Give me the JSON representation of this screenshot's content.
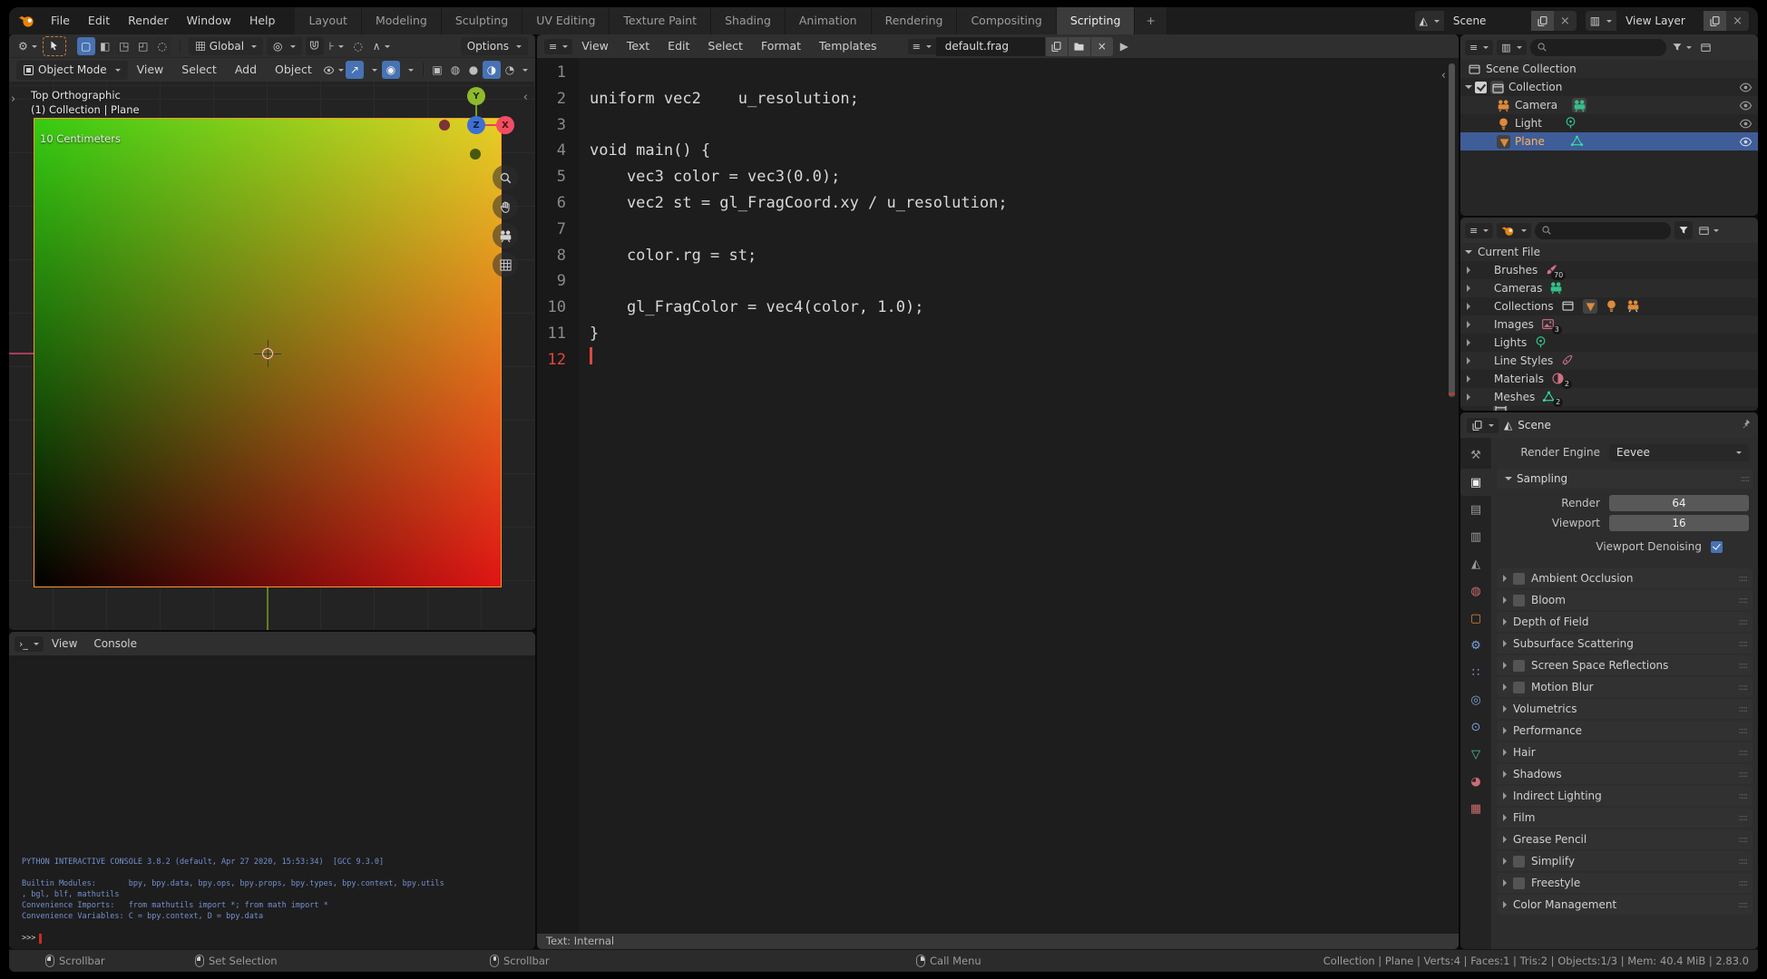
{
  "topbar": {
    "menus": [
      "File",
      "Edit",
      "Render",
      "Window",
      "Help"
    ],
    "tabs": [
      "Layout",
      "Modeling",
      "Sculpting",
      "UV Editing",
      "Texture Paint",
      "Shading",
      "Animation",
      "Rendering",
      "Compositing",
      "Scripting"
    ],
    "active_tab": "Scripting",
    "add_tab": "+",
    "scene_selector": "Scene",
    "view_layer_selector": "View Layer"
  },
  "tool_settings": {
    "orientation": "Global",
    "options_label": "Options"
  },
  "viewport": {
    "mode_selector": "Object Mode",
    "menus": [
      "View",
      "Select",
      "Add",
      "Object"
    ],
    "view_label": "Top Orthographic",
    "context_label": "(1) Collection | Plane",
    "scale_label": "10 Centimeters",
    "gizmo": {
      "x": "X",
      "y": "Y",
      "z": "Z"
    }
  },
  "console": {
    "menus": [
      "View",
      "Console"
    ],
    "lines": [
      "PYTHON INTERACTIVE CONSOLE 3.8.2 (default, Apr 27 2020, 15:53:34)  [GCC 9.3.0]",
      "",
      "Builtin Modules:       bpy, bpy.data, bpy.ops, bpy.props, bpy.types, bpy.context, bpy.utils",
      ", bgl, blf, mathutils",
      "Convenience Imports:   from mathutils import *; from math import *",
      "Convenience Variables: C = bpy.context, D = bpy.data"
    ],
    "prompt": ">>>"
  },
  "text_editor": {
    "menus": [
      "View",
      "Text",
      "Edit",
      "Select",
      "Format",
      "Templates"
    ],
    "filename": "default.frag",
    "footer": "Text: Internal",
    "lines": [
      {
        "n": "1",
        "code": ""
      },
      {
        "n": "2",
        "code": "uniform vec2    u_resolution;"
      },
      {
        "n": "3",
        "code": ""
      },
      {
        "n": "4",
        "code": "void main() {"
      },
      {
        "n": "5",
        "code": "    vec3 color = vec3(0.0);"
      },
      {
        "n": "6",
        "code": "    vec2 st = gl_FragCoord.xy / u_resolution;"
      },
      {
        "n": "7",
        "code": ""
      },
      {
        "n": "8",
        "code": "    color.rg = st;"
      },
      {
        "n": "9",
        "code": ""
      },
      {
        "n": "10",
        "code": "    gl_FragColor = vec4(color, 1.0);"
      },
      {
        "n": "11",
        "code": "}"
      },
      {
        "n": "12",
        "code": ""
      }
    ]
  },
  "outliner": {
    "scene_collection": "Scene Collection",
    "collection": "Collection",
    "camera": "Camera",
    "light": "Light",
    "plane": "Plane"
  },
  "blend_outliner": {
    "root": "Current File",
    "items": [
      {
        "label": "Brushes",
        "count": "70"
      },
      {
        "label": "Cameras",
        "count": ""
      },
      {
        "label": "Collections",
        "count": ""
      },
      {
        "label": "Images",
        "count": "3"
      },
      {
        "label": "Lights",
        "count": ""
      },
      {
        "label": "Line Styles",
        "count": ""
      },
      {
        "label": "Materials",
        "count": "2"
      },
      {
        "label": "Meshes",
        "count": "2"
      }
    ]
  },
  "properties": {
    "breadcrumb": "Scene",
    "render_engine_label": "Render Engine",
    "render_engine_value": "Eevee",
    "sampling_title": "Sampling",
    "render_label": "Render",
    "render_value": "64",
    "viewport_label": "Viewport",
    "viewport_value": "16",
    "denoising_label": "Viewport Denoising",
    "sections": [
      {
        "label": "Ambient Occlusion",
        "checkbox": true
      },
      {
        "label": "Bloom",
        "checkbox": true
      },
      {
        "label": "Depth of Field",
        "checkbox": false
      },
      {
        "label": "Subsurface Scattering",
        "checkbox": false
      },
      {
        "label": "Screen Space Reflections",
        "checkbox": true
      },
      {
        "label": "Motion Blur",
        "checkbox": true
      },
      {
        "label": "Volumetrics",
        "checkbox": false
      },
      {
        "label": "Performance",
        "checkbox": false
      },
      {
        "label": "Hair",
        "checkbox": false
      },
      {
        "label": "Shadows",
        "checkbox": false
      },
      {
        "label": "Indirect Lighting",
        "checkbox": false
      },
      {
        "label": "Film",
        "checkbox": false
      },
      {
        "label": "Grease Pencil",
        "checkbox": false
      },
      {
        "label": "Simplify",
        "checkbox": true
      },
      {
        "label": "Freestyle",
        "checkbox": true
      },
      {
        "label": "Color Management",
        "checkbox": false
      }
    ]
  },
  "status_bar": {
    "hints": [
      "Scrollbar",
      "Set Selection",
      "Scrollbar",
      "Call Menu"
    ],
    "stats": "Collection | Plane | Verts:4 | Faces:1 | Tris:2 | Objects:1/3 | Mem: 40.4 MiB | 2.83.0"
  },
  "icons": {
    "editor_type_text": "≡",
    "editor_type_console": "›_",
    "editor_type_outliner": "≡",
    "play": "▶",
    "close": "×",
    "gizmos": "↗",
    "overlays": "◉",
    "xray": "▣",
    "shading_wireframe": "◍",
    "shading_solid": "●",
    "shading_material": "◑",
    "shading_rendered": "◔",
    "tool_fallback": "⚙",
    "proportional": "◌",
    "falloff": "∧",
    "scene": "◭",
    "view_layer": "▥",
    "sidebar_open_left": "›",
    "sidebar_open_right": "‹",
    "drag_handle": "::::",
    "prop_tabs": [
      "⚒",
      "▣",
      "▤",
      "▥",
      "◭",
      "◍",
      "▢",
      "⚙",
      "∷",
      "◎",
      "⊙",
      "▽",
      "◕",
      "▦"
    ]
  },
  "colors": {
    "accent_blue": "#4772b3",
    "selection_orange": "#ff962b",
    "selected_object_text": "#ffb357",
    "console_info_blue": "#7590cf",
    "error_red": "#e0483e",
    "plane_green": "#35cc12",
    "plane_red": "#e01414"
  }
}
